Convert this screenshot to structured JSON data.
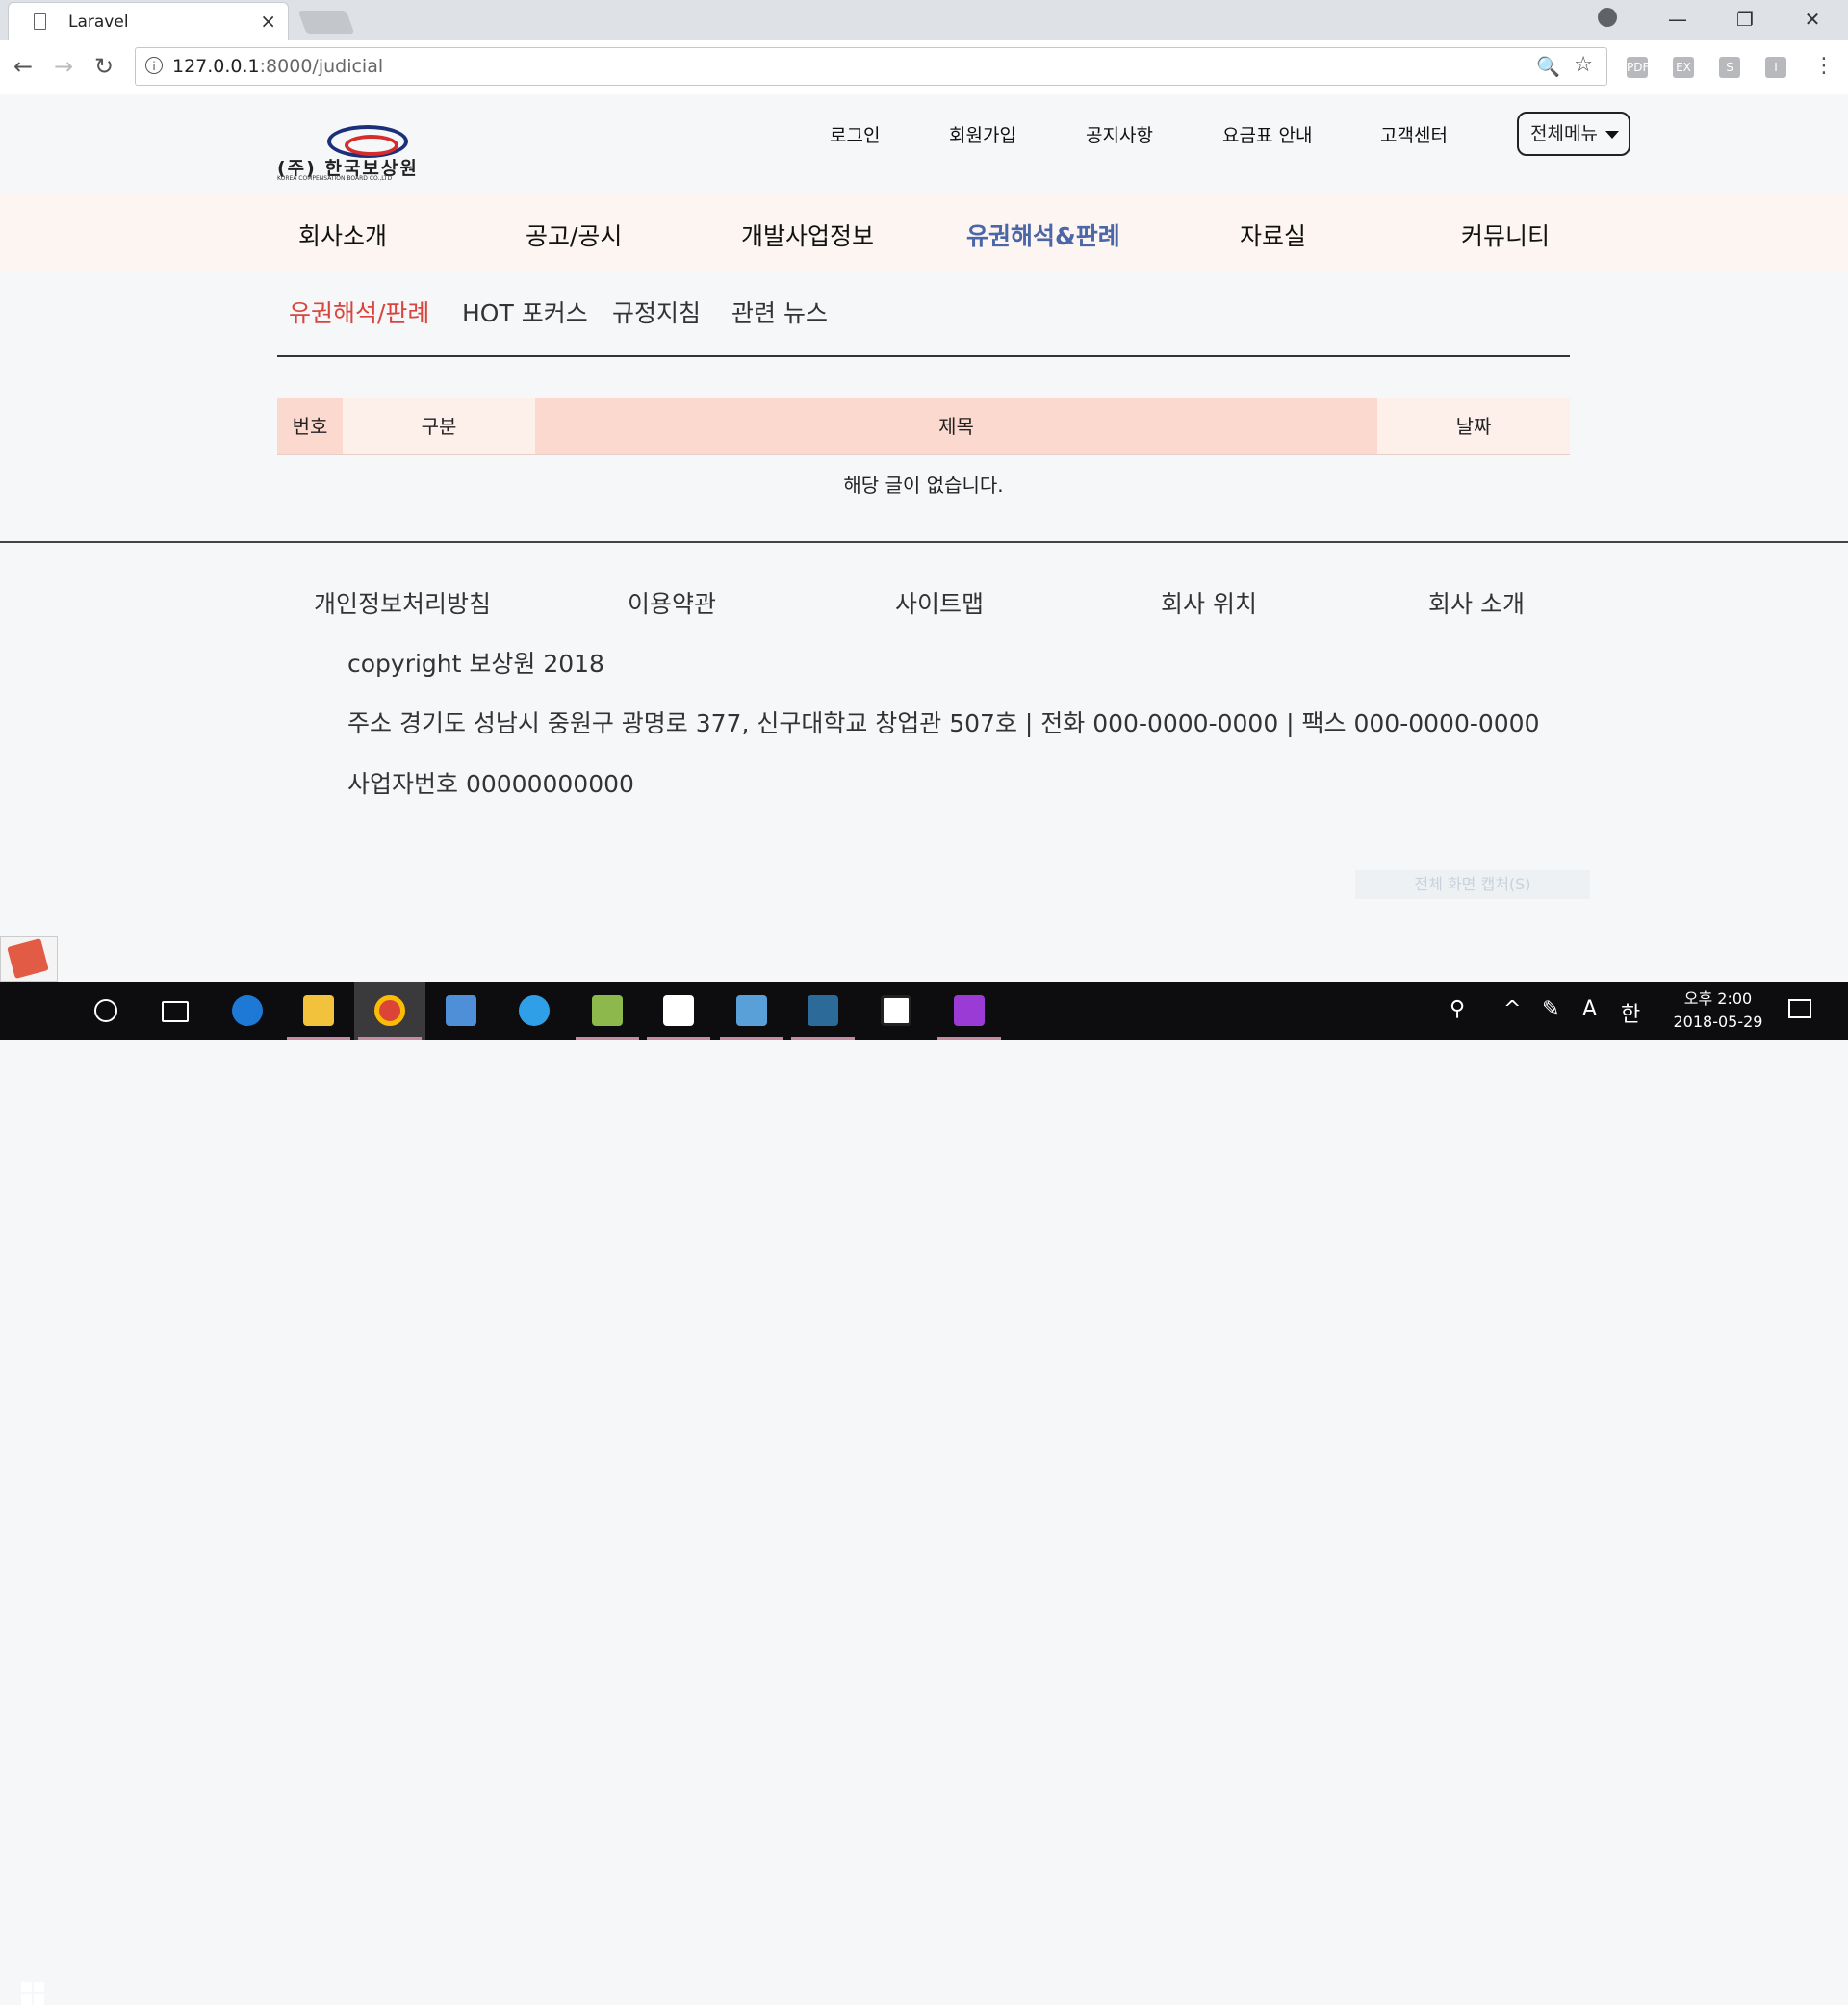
{
  "browser": {
    "tab_title": "Laravel",
    "tab_close": "×",
    "url_host": "127.0.0.1",
    "url_path": ":8000/judicial",
    "info_icon": "i",
    "back_icon": "←",
    "forward_icon": "→",
    "reload_icon": "↻",
    "zoom_icon": "🔍",
    "star_icon": "☆",
    "minimize": "—",
    "restore": "❐",
    "close": "✕",
    "menu": "⋮",
    "extensions": [
      "PDF",
      "EX",
      "S",
      "I"
    ]
  },
  "site": {
    "logo_text": "(주) 한국보상원",
    "logo_subtext": "KOREA COMPENSATION BOARD CO.,LTD",
    "top_links": [
      "로그인",
      "회원가입",
      "공지사항",
      "요금표 안내",
      "고객센터"
    ],
    "all_menu_label": "전체메뉴",
    "main_nav": [
      "회사소개",
      "공고/공시",
      "개발사업정보",
      "유권해석&판례",
      "자료실",
      "커뮤니티"
    ],
    "main_nav_active": "유권해석&판례",
    "sub_nav": [
      "유권해석/판례",
      "HOT 포커스",
      "규정지침",
      "관련 뉴스"
    ],
    "sub_nav_active": "유권해석/판례",
    "table_headers": [
      "번호",
      "구분",
      "제목",
      "날짜"
    ],
    "empty_message": "해당 글이 없습니다.",
    "footer_links": [
      "개인정보처리방침",
      "이용약관",
      "사이트맵",
      "회사 위치",
      "회사 소개"
    ],
    "copyright": "copyright 보상원 2018",
    "address_line": "주소 경기도 성남시 중원구 광명로 377, 신구대학교 창업관 507호 | 전화 000-0000-0000 | 팩스 000-0000-0000",
    "business_number": "사업자번호 00000000000",
    "capture_button": "전체 화면 캡처(S)"
  },
  "taskbar": {
    "apps": [
      "edge",
      "file-explorer",
      "chrome",
      "control-panel",
      "internet-explorer",
      "lambda-app",
      "sticky-app",
      "archive-app",
      "mysql-workbench",
      "photos",
      "phpstorm"
    ],
    "tray_ime": "A",
    "tray_lang": "한",
    "clock_time": "오후 2:00",
    "clock_date": "2018-05-29"
  },
  "colors": {
    "accent_blue": "#4b67a8",
    "accent_red": "#d9453c",
    "nav_band": "#fdf5f1",
    "table_head": "#fcd9cf"
  }
}
